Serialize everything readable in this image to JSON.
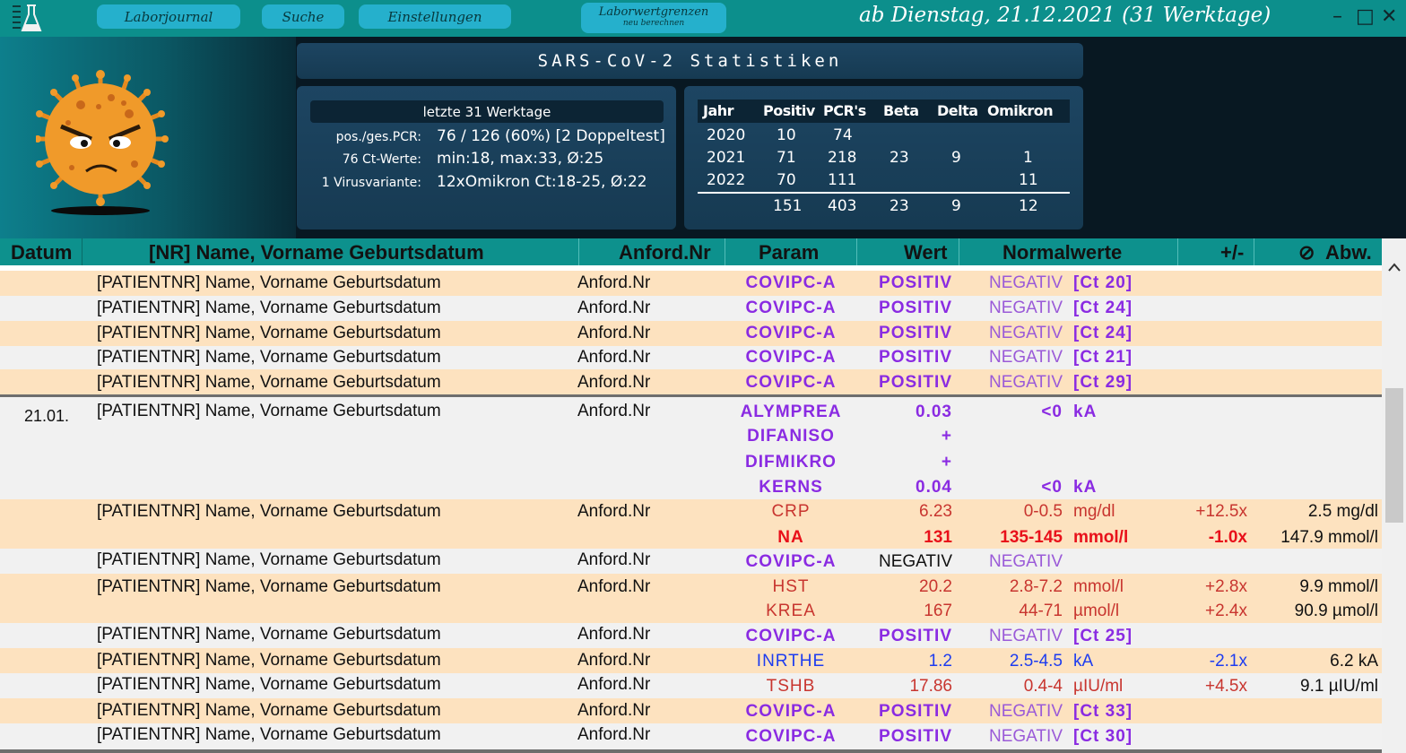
{
  "nav": {
    "journal": "Laborjournal",
    "search": "Suche",
    "settings": "Einstellungen",
    "limits_line1": "Laborwertgrenzen",
    "limits_line2": "neu berechnen"
  },
  "date_range": "ab Dienstag, 21.12.2021 (31 Werktage)",
  "window_controls": {
    "minimize": "–",
    "maximize": "□",
    "close": "✕"
  },
  "stats": {
    "title": "SARS-CoV-2 Statistiken",
    "period": "letzte 31 Werktage",
    "rows": [
      {
        "label": "pos./ges.PCR:",
        "value": "76 / 126 (60%) [2 Doppeltest]"
      },
      {
        "label": "76 Ct-Werte:",
        "value": "min:18, max:33, Ø:25"
      },
      {
        "label": "1 Virusvariante:",
        "value": "12xOmikron Ct:18-25, Ø:22"
      }
    ],
    "year_headers": [
      "Jahr",
      "Positiv",
      "PCR's",
      "Beta",
      "Delta",
      "Omikron"
    ],
    "years": [
      {
        "jahr": "2020",
        "positiv": "10",
        "pcr": "74",
        "beta": "",
        "delta": "",
        "omikron": ""
      },
      {
        "jahr": "2021",
        "positiv": "71",
        "pcr": "218",
        "beta": "23",
        "delta": "9",
        "omikron": "1"
      },
      {
        "jahr": "2022",
        "positiv": "70",
        "pcr": "111",
        "beta": "",
        "delta": "",
        "omikron": "11"
      }
    ],
    "totals": {
      "positiv": "151",
      "pcr": "403",
      "beta": "23",
      "delta": "9",
      "omikron": "12"
    }
  },
  "columns": {
    "datum": "Datum",
    "name": "[NR] Name, Vorname Geburtsdatum",
    "anford": "Anford.Nr",
    "param": "Param",
    "wert": "Wert",
    "normal": "Normalwerte",
    "pm": "+/-",
    "abw_icon": "⊘",
    "abw": "Abw."
  },
  "patient_placeholder": "[PATIENTNR] Name, Vorname Geburtsdatum",
  "anford_placeholder": "Anford.Nr",
  "group_date": "21.01.",
  "rows": [
    {
      "param": "COVIPC-A",
      "wert": "POSITIV",
      "norm": "NEGATIV",
      "unit": "[Ct 20]"
    },
    {
      "param": "COVIPC-A",
      "wert": "POSITIV",
      "norm": "NEGATIV",
      "unit": "[Ct 24]"
    },
    {
      "param": "COVIPC-A",
      "wert": "POSITIV",
      "norm": "NEGATIV",
      "unit": "[Ct 24]"
    },
    {
      "param": "COVIPC-A",
      "wert": "POSITIV",
      "norm": "NEGATIV",
      "unit": "[Ct 21]"
    },
    {
      "param": "COVIPC-A",
      "wert": "POSITIV",
      "norm": "NEGATIV",
      "unit": "[Ct 29]"
    },
    {
      "param": "ALYMPREA",
      "wert": "0.03",
      "norm": "<0",
      "unit": "kA"
    },
    {
      "param": "DIFANISO",
      "wert": "+"
    },
    {
      "param": "DIFMIKRO",
      "wert": "+"
    },
    {
      "param": "KERNS",
      "wert": "0.04",
      "norm": "<0",
      "unit": "kA"
    },
    {
      "param": "CRP",
      "wert": "6.23",
      "norm": "0-0.5",
      "unit": "mg/dl",
      "pm": "+12.5x",
      "abw": "2.5 mg/dl"
    },
    {
      "param": "NA",
      "wert": "131",
      "norm": "135-145",
      "unit": "mmol/l",
      "pm": "-1.0x",
      "abw": "147.9 mmol/l"
    },
    {
      "param": "COVIPC-A",
      "wert": "NEGATIV",
      "norm": "NEGATIV"
    },
    {
      "param": "HST",
      "wert": "20.2",
      "norm": "2.8-7.2",
      "unit": "mmol/l",
      "pm": "+2.8x",
      "abw": "9.9 mmol/l"
    },
    {
      "param": "KREA",
      "wert": "167",
      "norm": "44-71",
      "unit": "µmol/l",
      "pm": "+2.4x",
      "abw": "90.9 µmol/l"
    },
    {
      "param": "COVIPC-A",
      "wert": "POSITIV",
      "norm": "NEGATIV",
      "unit": "[Ct 25]"
    },
    {
      "param": "INRTHE",
      "wert": "1.2",
      "norm": "2.5-4.5",
      "unit": "kA",
      "pm": "-2.1x",
      "abw": "6.2 kA"
    },
    {
      "param": "TSHB",
      "wert": "17.86",
      "norm": "0.4-4",
      "unit": "µIU/ml",
      "pm": "+4.5x",
      "abw": "9.1 µIU/ml"
    },
    {
      "param": "COVIPC-A",
      "wert": "POSITIV",
      "norm": "NEGATIV",
      "unit": "[Ct 33]"
    },
    {
      "param": "COVIPC-A",
      "wert": "POSITIV",
      "norm": "NEGATIV",
      "unit": "[Ct 30]"
    }
  ],
  "colors": {
    "teal": "#0c8f8c",
    "orange_row": "#fde2bf",
    "grey_row": "#f1f1f1",
    "purple": "#8a2be2",
    "red": "#c8352f",
    "red_bold": "#e8101a",
    "blue": "#1d3cf0"
  }
}
